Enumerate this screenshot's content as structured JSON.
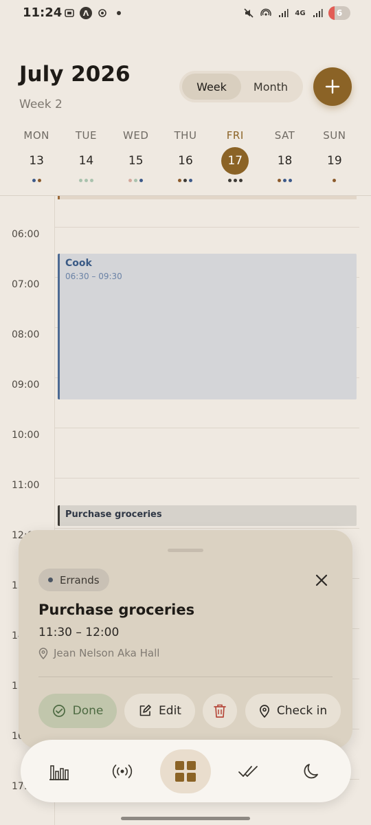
{
  "status_bar": {
    "time": "11:24",
    "network": "4G",
    "battery": "6"
  },
  "header": {
    "month_title": "July 2026",
    "week_label": "Week 2",
    "view_toggle": {
      "week": "Week",
      "month": "Month",
      "selected": "Week"
    },
    "add_icon": "plus-icon"
  },
  "days": [
    {
      "name": "MON",
      "num": "13",
      "dots": [
        "#3d5a8a",
        "#8b5a2b"
      ]
    },
    {
      "name": "TUE",
      "num": "14",
      "dots": [
        "#a9c2ad",
        "#a9c2ad",
        "#a9c2ad"
      ]
    },
    {
      "name": "WED",
      "num": "15",
      "dots": [
        "#d4a99c",
        "#a9c2ad",
        "#3d5a8a"
      ]
    },
    {
      "name": "THU",
      "num": "16",
      "dots": [
        "#8b5a2b",
        "#3d3a35",
        "#3d5a8a"
      ]
    },
    {
      "name": "FRI",
      "num": "17",
      "dots": [
        "#3d3a35",
        "#3d3a35",
        "#3d3a35"
      ],
      "today": true
    },
    {
      "name": "SAT",
      "num": "18",
      "dots": [
        "#8b5a2b",
        "#3d5a8a",
        "#3d5a8a"
      ]
    },
    {
      "name": "SUN",
      "num": "19",
      "dots": [
        "#8b5a2b"
      ]
    }
  ],
  "timeline": {
    "hours": [
      "06:00",
      "07:00",
      "08:00",
      "09:00",
      "10:00",
      "11:00",
      "12:00",
      "13:00",
      "14:00",
      "15:00",
      "16:00",
      "17:00"
    ],
    "events": [
      {
        "title": "Cook",
        "time": "06:30 – 09:30"
      },
      {
        "title": "Purchase groceries"
      }
    ]
  },
  "sheet": {
    "category": "Errands",
    "title": "Purchase groceries",
    "time": "11:30 – 12:00",
    "location": "Jean Nelson Aka Hall",
    "actions": {
      "done": "Done",
      "edit": "Edit",
      "check_in": "Check in"
    }
  },
  "nav": {
    "items": [
      "stats-icon",
      "broadcast-icon",
      "grid-icon",
      "double-check-icon",
      "moon-icon"
    ],
    "active": "grid-icon"
  },
  "colors": {
    "accent": "#8b6326",
    "background": "#efe9e1",
    "sheet": "#dbd2c2",
    "event_blue": "#4c6a93"
  }
}
